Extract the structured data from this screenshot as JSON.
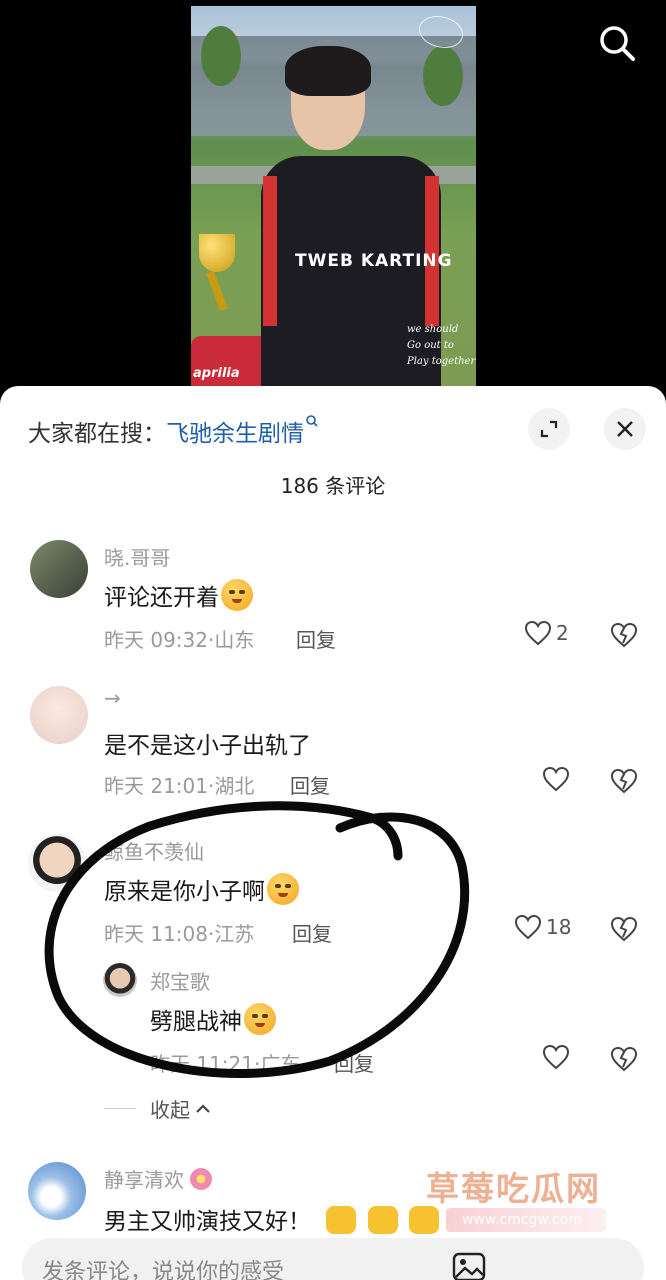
{
  "hot_search": {
    "prefix": "大家都在搜：",
    "term": "飞驰余生剧情"
  },
  "comment_count": "186 条评论",
  "video": {
    "suit_text": "TWEB KARTING",
    "brand_text": "aprilia",
    "script_text": [
      "we should",
      "Go out to",
      "Play together"
    ]
  },
  "comments": [
    {
      "user": "晓.哥哥",
      "text": "评论还开着",
      "time": "昨天 09:32",
      "location": "山东",
      "reply_label": "回复",
      "likes": "2"
    },
    {
      "user": "→",
      "text": "是不是这小子出轨了",
      "time": "昨天 21:01",
      "location": "湖北",
      "reply_label": "回复",
      "likes": ""
    },
    {
      "user": "鲸鱼不羡仙",
      "text": "原来是你小子啊",
      "time": "昨天 11:08",
      "location": "江苏",
      "reply_label": "回复",
      "likes": "18",
      "replies": [
        {
          "user": "郑宝歌",
          "text": "劈腿战神",
          "time": "昨天 11:21",
          "location": "广东",
          "reply_label": "回复",
          "likes": ""
        }
      ],
      "collapse_label": "收起"
    },
    {
      "user": "静享清欢",
      "text": "男主又帅演技又好！",
      "time": "",
      "location": ""
    }
  ],
  "watermark": {
    "title": "草莓吃瓜网",
    "url": "www.cmcgw.com"
  },
  "input": {
    "placeholder": "发条评论，说说你的感受"
  },
  "colors": {
    "link_blue": "#1f5fa6",
    "meta_gray": "#9a9a9a"
  },
  "icons": [
    "search-icon",
    "expand-icon",
    "close-icon",
    "heart-icon",
    "broken-heart-icon",
    "image-icon",
    "chevron-up-icon"
  ]
}
